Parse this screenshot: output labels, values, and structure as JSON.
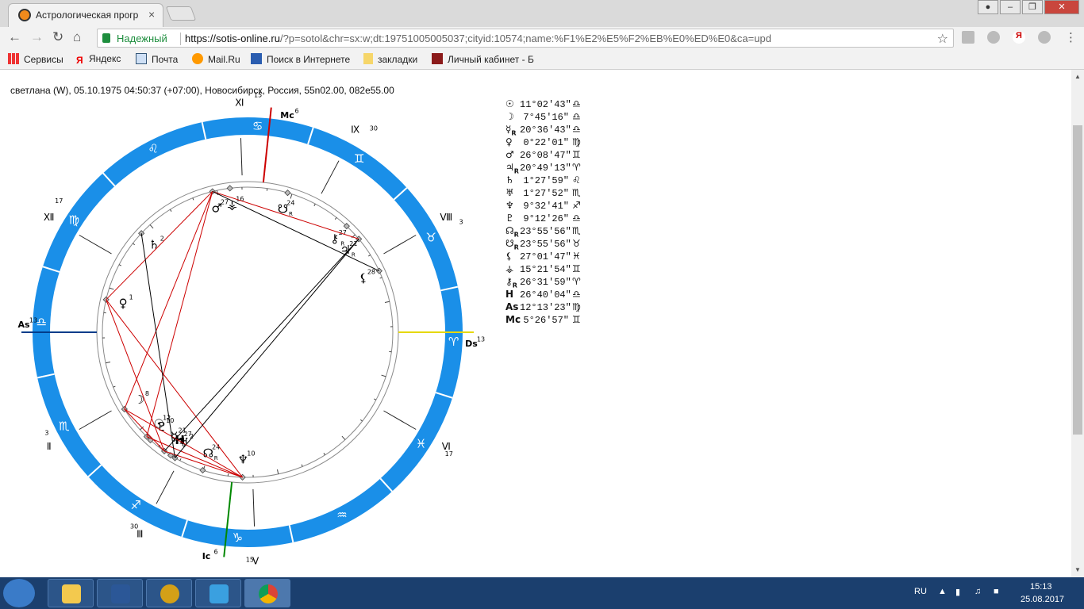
{
  "browser": {
    "tab_title": "Астрологическая прогр",
    "tab_close": "×",
    "security_label": "Надежный",
    "url_host": "https://sotis-online.ru",
    "url_rest": "/?p=sotol&chr=sx:w;dt:19751005005037;cityid:10574;name:%F1%E2%E5%F2%EB%E0%ED%E0&ca=upd",
    "bookmarks": [
      "Сервисы",
      "Яндекс",
      "Почта",
      "Mail.Ru",
      "Поиск в Интернете",
      "закладки",
      "Личный кабинет - Б"
    ]
  },
  "chart_header": "светлана (W), 05.10.1975 04:50:37 (+07:00), Новосибирск, Россия, 55n02.00, 082e55.00",
  "colors": {
    "zodiac_ring": "#1a8fe8",
    "aspect_red": "#cc0000",
    "aspect_black": "#000000",
    "asc_axis": "#003c8a",
    "dsc_axis": "#e6d800",
    "mc_axis": "#cc0000",
    "ic_axis": "#008800"
  },
  "zodiac_glyphs": [
    "♈",
    "♉",
    "♊",
    "♋",
    "♌",
    "♍",
    "♎",
    "♏",
    "♐",
    "♑",
    "♒",
    "♓"
  ],
  "axes": [
    {
      "id": "asc",
      "label": "As",
      "deg": "13"
    },
    {
      "id": "dsc",
      "label": "Ds",
      "deg": "13"
    },
    {
      "id": "mc",
      "label": "Mc",
      "deg": "6"
    },
    {
      "id": "ic",
      "label": "Ic",
      "deg": "6"
    }
  ],
  "houses": [
    {
      "label": "Ⅱ",
      "deg": "3"
    },
    {
      "label": "Ⅲ",
      "deg": "30"
    },
    {
      "label": "Ⅴ",
      "deg": "15"
    },
    {
      "label": "Ⅵ",
      "deg": "17"
    },
    {
      "label": "Ⅷ",
      "deg": "3"
    },
    {
      "label": "Ⅸ",
      "deg": "30"
    },
    {
      "label": "Ⅺ",
      "deg": "15"
    },
    {
      "label": "Ⅻ",
      "deg": "17"
    }
  ],
  "planets": [
    {
      "glyph": "☉",
      "deg": "12",
      "retro": ""
    },
    {
      "glyph": "☽",
      "deg": "8",
      "retro": ""
    },
    {
      "glyph": "☿",
      "deg": "21",
      "retro": "R"
    },
    {
      "glyph": "♀",
      "deg": "1",
      "retro": ""
    },
    {
      "glyph": "♂",
      "deg": "27",
      "retro": ""
    },
    {
      "glyph": "♃",
      "deg": "21",
      "retro": "R"
    },
    {
      "glyph": "♄",
      "deg": "2",
      "retro": ""
    },
    {
      "glyph": "♅",
      "deg": "2",
      "retro": ""
    },
    {
      "glyph": "♆",
      "deg": "10",
      "retro": ""
    },
    {
      "glyph": "♇",
      "deg": "10",
      "retro": ""
    },
    {
      "glyph": "☊",
      "deg": "24",
      "retro": "R"
    },
    {
      "glyph": "☋",
      "deg": "24",
      "retro": "R"
    },
    {
      "glyph": "⚸",
      "deg": "28",
      "retro": ""
    },
    {
      "glyph": "⚶",
      "deg": "16",
      "retro": ""
    },
    {
      "glyph": "⚷",
      "deg": "27",
      "retro": "R"
    },
    {
      "glyph": "H",
      "deg": "27",
      "retro": ""
    }
  ],
  "positions": [
    {
      "glyph": "☉",
      "retro": "",
      "value": "11°02′43″",
      "sign": "♎"
    },
    {
      "glyph": "☽",
      "retro": "",
      "value": "7°45′16″",
      "sign": "♎"
    },
    {
      "glyph": "☿",
      "retro": "R",
      "value": "20°36′43″",
      "sign": "♎"
    },
    {
      "glyph": "♀",
      "retro": "",
      "value": "0°22′01″",
      "sign": "♍"
    },
    {
      "glyph": "♂",
      "retro": "",
      "value": "26°08′47″",
      "sign": "♊"
    },
    {
      "glyph": "♃",
      "retro": "R",
      "value": "20°49′13″",
      "sign": "♈"
    },
    {
      "glyph": "♄",
      "retro": "",
      "value": "1°27′59″",
      "sign": "♌"
    },
    {
      "glyph": "♅",
      "retro": "",
      "value": "1°27′52″",
      "sign": "♏"
    },
    {
      "glyph": "♆",
      "retro": "",
      "value": "9°32′41″",
      "sign": "♐"
    },
    {
      "glyph": "♇",
      "retro": "",
      "value": "9°12′26″",
      "sign": "♎"
    },
    {
      "glyph": "☊",
      "retro": "R",
      "value": "23°55′56″",
      "sign": "♏"
    },
    {
      "glyph": "☋",
      "retro": "R",
      "value": "23°55′56″",
      "sign": "♉"
    },
    {
      "glyph": "⚸",
      "retro": "",
      "value": "27°01′47″",
      "sign": "♓"
    },
    {
      "glyph": "⚶",
      "retro": "",
      "value": "15°21′54″",
      "sign": "♊"
    },
    {
      "glyph": "⚷",
      "retro": "R",
      "value": "26°31′59″",
      "sign": "♈"
    },
    {
      "glyph": "H",
      "retro": "",
      "value": "26°40′04″",
      "sign": "♎"
    },
    {
      "glyph": "As",
      "retro": "",
      "value": "12°13′23″",
      "sign": "♍"
    },
    {
      "glyph": "Mc",
      "retro": "",
      "value": "5°26′57″",
      "sign": "♊"
    }
  ],
  "taskbar": {
    "lang": "RU",
    "time": "15:13",
    "date": "25.08.2017"
  }
}
